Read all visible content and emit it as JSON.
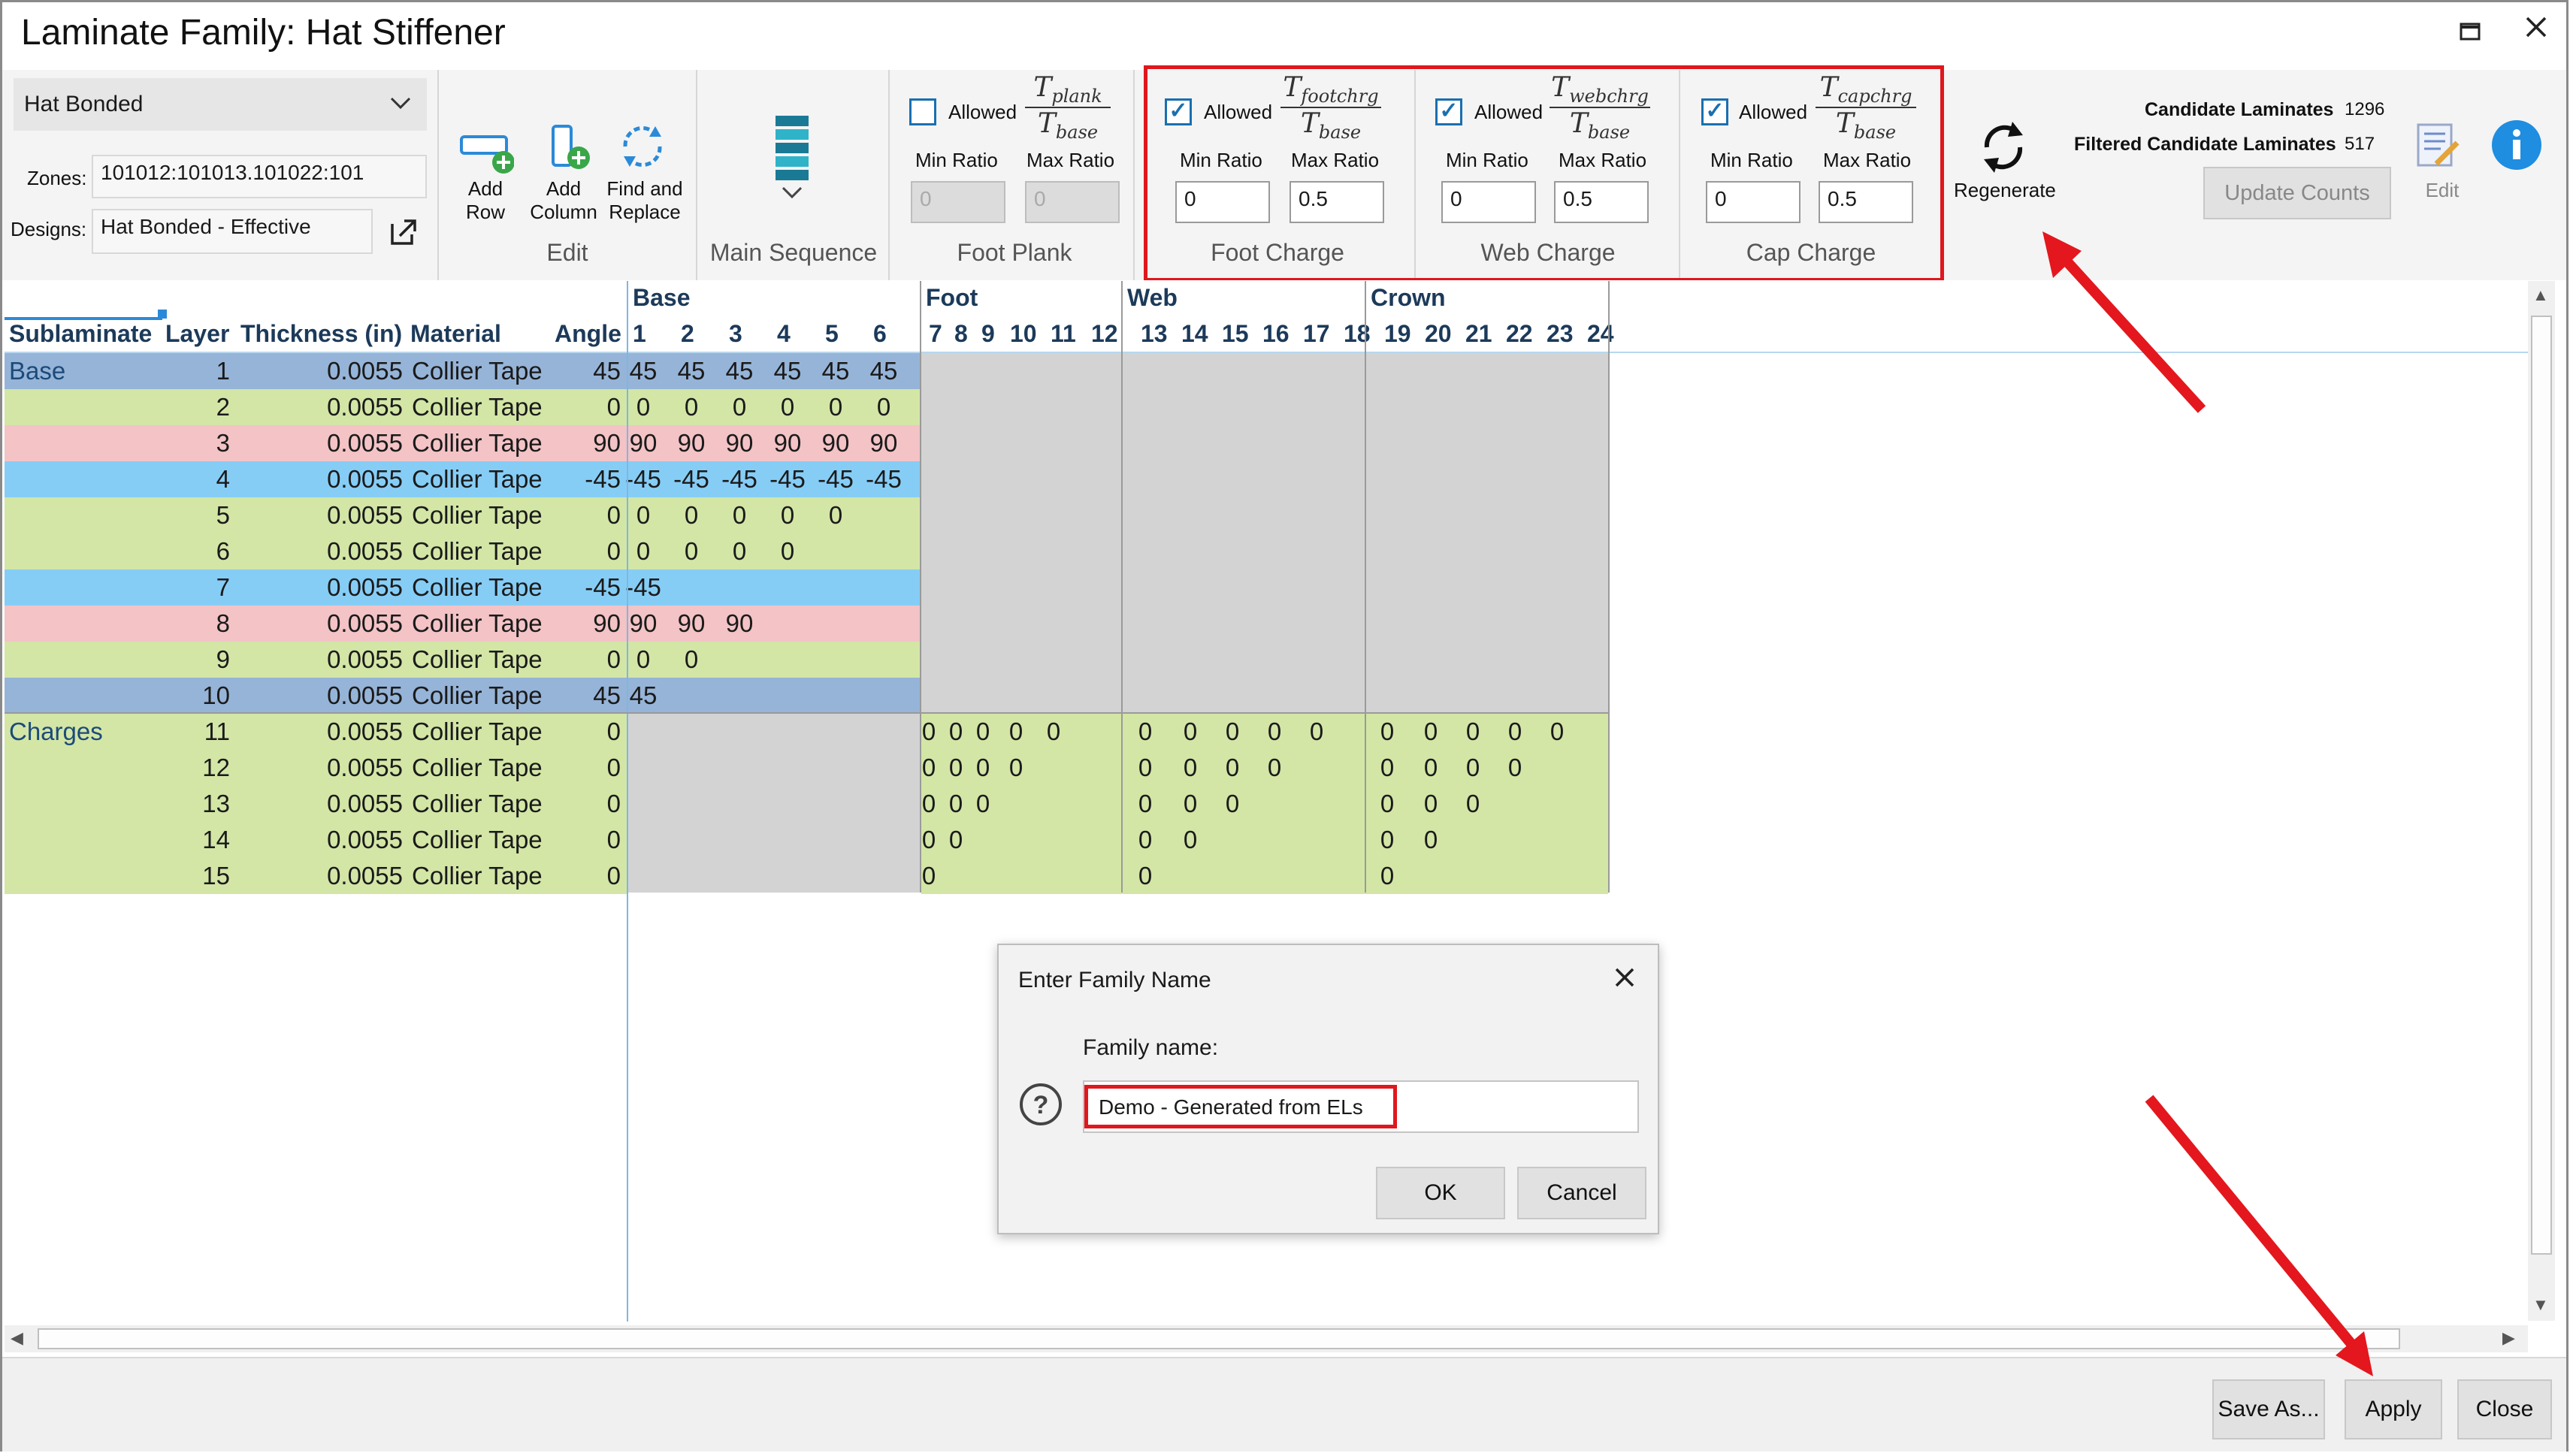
{
  "window": {
    "title": "Laminate Family: Hat Stiffener",
    "maximize_icon": "maximize-icon",
    "close_icon": "close-icon"
  },
  "ribbon": {
    "family_select": "Hat Bonded",
    "zones_label": "Zones:",
    "zones_value": "101012:101013.101022:101",
    "designs_label": "Designs:",
    "designs_value": "Hat  Bonded  -  Effective",
    "edit_group": {
      "label": "Edit",
      "add_row": [
        "Add",
        "Row"
      ],
      "add_column": [
        "Add",
        "Column"
      ],
      "find_replace": [
        "Find and",
        "Replace"
      ]
    },
    "main_sequence": "Main Sequence",
    "foot_plank": {
      "allowed": "Allowed",
      "checked": false,
      "min_label": "Min Ratio",
      "max_label": "Max Ratio",
      "min": "0",
      "max": "0",
      "num": "T",
      "num_sub": "plank",
      "den": "T",
      "den_sub": "base",
      "group": "Foot Plank"
    },
    "foot_charge": {
      "allowed": "Allowed",
      "checked": true,
      "min_label": "Min Ratio",
      "max_label": "Max Ratio",
      "min": "0",
      "max": "0.5",
      "num": "T",
      "num_sub": "footchrg",
      "den": "T",
      "den_sub": "base",
      "group": "Foot Charge"
    },
    "web_charge": {
      "allowed": "Allowed",
      "checked": true,
      "min_label": "Min Ratio",
      "max_label": "Max Ratio",
      "min": "0",
      "max": "0.5",
      "num": "T",
      "num_sub": "webchrg",
      "den": "T",
      "den_sub": "base",
      "group": "Web Charge"
    },
    "cap_charge": {
      "allowed": "Allowed",
      "checked": true,
      "min_label": "Min Ratio",
      "max_label": "Max Ratio",
      "min": "0",
      "max": "0.5",
      "num": "T",
      "num_sub": "capchrg",
      "den": "T",
      "den_sub": "base",
      "group": "Cap Charge"
    },
    "regenerate": "Regenerate",
    "candidate_label": "Candidate Laminates",
    "candidate_value": "1296",
    "filtered_label": "Filtered Candidate Laminates",
    "filtered_value": "517",
    "update_counts": "Update Counts",
    "edit_label": "Edit"
  },
  "grid": {
    "group_headers": [
      "Base",
      "Foot",
      "Web",
      "Crown"
    ],
    "col_headers": [
      "Sublaminate",
      "Layer",
      "Thickness (in)",
      "Material",
      "Angle"
    ],
    "seq_numbers": [
      "1",
      "2",
      "3",
      "4",
      "5",
      "6",
      "7",
      "8",
      "9",
      "10",
      "11",
      "12",
      "13",
      "14",
      "15",
      "16",
      "17",
      "18",
      "19",
      "20",
      "21",
      "22",
      "23",
      "24"
    ],
    "rows": [
      {
        "sub": "Base",
        "layer": "1",
        "thk": "0.0055",
        "mat": "Collier Tape",
        "angle": "45",
        "color": "#96b4d8",
        "base": [
          "45",
          "45",
          "45",
          "45",
          "45",
          "45"
        ],
        "foot": [],
        "web": [],
        "crown": []
      },
      {
        "sub": "",
        "layer": "2",
        "thk": "0.0055",
        "mat": "Collier Tape",
        "angle": "0",
        "color": "#d3e6a6",
        "base": [
          "0",
          "0",
          "0",
          "0",
          "0",
          "0"
        ],
        "foot": [],
        "web": [],
        "crown": []
      },
      {
        "sub": "",
        "layer": "3",
        "thk": "0.0055",
        "mat": "Collier Tape",
        "angle": "90",
        "color": "#f3c3c6",
        "base": [
          "90",
          "90",
          "90",
          "90",
          "90",
          "90"
        ],
        "foot": [],
        "web": [],
        "crown": []
      },
      {
        "sub": "",
        "layer": "4",
        "thk": "0.0055",
        "mat": "Collier Tape",
        "angle": "-45",
        "color": "#86cdf6",
        "base": [
          "-45",
          "-45",
          "-45",
          "-45",
          "-45",
          "-45"
        ],
        "foot": [],
        "web": [],
        "crown": []
      },
      {
        "sub": "",
        "layer": "5",
        "thk": "0.0055",
        "mat": "Collier Tape",
        "angle": "0",
        "color": "#d3e6a6",
        "base": [
          "0",
          "0",
          "0",
          "0",
          "0",
          ""
        ],
        "foot": [],
        "web": [],
        "crown": []
      },
      {
        "sub": "",
        "layer": "6",
        "thk": "0.0055",
        "mat": "Collier Tape",
        "angle": "0",
        "color": "#d3e6a6",
        "base": [
          "0",
          "0",
          "0",
          "0",
          "",
          ""
        ],
        "foot": [],
        "web": [],
        "crown": []
      },
      {
        "sub": "",
        "layer": "7",
        "thk": "0.0055",
        "mat": "Collier Tape",
        "angle": "-45",
        "color": "#86cdf6",
        "base": [
          "-45",
          "",
          "",
          "",
          "",
          ""
        ],
        "foot": [],
        "web": [],
        "crown": []
      },
      {
        "sub": "",
        "layer": "8",
        "thk": "0.0055",
        "mat": "Collier Tape",
        "angle": "90",
        "color": "#f3c3c6",
        "base": [
          "90",
          "90",
          "90",
          "",
          "",
          ""
        ],
        "foot": [],
        "web": [],
        "crown": []
      },
      {
        "sub": "",
        "layer": "9",
        "thk": "0.0055",
        "mat": "Collier Tape",
        "angle": "0",
        "color": "#d3e6a6",
        "base": [
          "0",
          "0",
          "",
          "",
          "",
          ""
        ],
        "foot": [],
        "web": [],
        "crown": []
      },
      {
        "sub": "",
        "layer": "10",
        "thk": "0.0055",
        "mat": "Collier Tape",
        "angle": "45",
        "color": "#96b4d8",
        "base": [
          "45",
          "",
          "",
          "",
          "",
          ""
        ],
        "foot": [],
        "web": [],
        "crown": []
      },
      {
        "sub": "Charges",
        "layer": "11",
        "thk": "0.0055",
        "mat": "Collier Tape",
        "angle": "0",
        "color": "#d3e6a6",
        "base": [],
        "foot": [
          "0",
          "0",
          "0",
          "0",
          "0",
          ""
        ],
        "web": [
          "0",
          "0",
          "0",
          "0",
          "0",
          ""
        ],
        "crown": [
          "0",
          "0",
          "0",
          "0",
          "0",
          ""
        ]
      },
      {
        "sub": "",
        "layer": "12",
        "thk": "0.0055",
        "mat": "Collier Tape",
        "angle": "0",
        "color": "#d3e6a6",
        "base": [],
        "foot": [
          "0",
          "0",
          "0",
          "0",
          "",
          ""
        ],
        "web": [
          "0",
          "0",
          "0",
          "0",
          "",
          ""
        ],
        "crown": [
          "0",
          "0",
          "0",
          "0",
          "",
          ""
        ]
      },
      {
        "sub": "",
        "layer": "13",
        "thk": "0.0055",
        "mat": "Collier Tape",
        "angle": "0",
        "color": "#d3e6a6",
        "base": [],
        "foot": [
          "0",
          "0",
          "0",
          "",
          "",
          ""
        ],
        "web": [
          "0",
          "0",
          "0",
          "",
          "",
          ""
        ],
        "crown": [
          "0",
          "0",
          "0",
          "",
          "",
          ""
        ]
      },
      {
        "sub": "",
        "layer": "14",
        "thk": "0.0055",
        "mat": "Collier Tape",
        "angle": "0",
        "color": "#d3e6a6",
        "base": [],
        "foot": [
          "0",
          "0",
          "",
          "",
          "",
          ""
        ],
        "web": [
          "0",
          "0",
          "",
          "",
          "",
          ""
        ],
        "crown": [
          "0",
          "0",
          "",
          "",
          "",
          ""
        ]
      },
      {
        "sub": "",
        "layer": "15",
        "thk": "0.0055",
        "mat": "Collier Tape",
        "angle": "0",
        "color": "#d3e6a6",
        "base": [],
        "foot": [
          "0",
          "",
          "",
          "",
          "",
          ""
        ],
        "web": [
          "0",
          "",
          "",
          "",
          "",
          ""
        ],
        "crown": [
          "0",
          "",
          "",
          "",
          "",
          ""
        ]
      }
    ]
  },
  "dialog": {
    "title": "Enter Family Name",
    "field_label": "Family name:",
    "field_value": "Demo - Generated from ELs",
    "ok": "OK",
    "cancel": "Cancel"
  },
  "footer": {
    "save_as": "Save As...",
    "apply": "Apply",
    "close": "Close"
  },
  "annotation_color": "#e3171d"
}
